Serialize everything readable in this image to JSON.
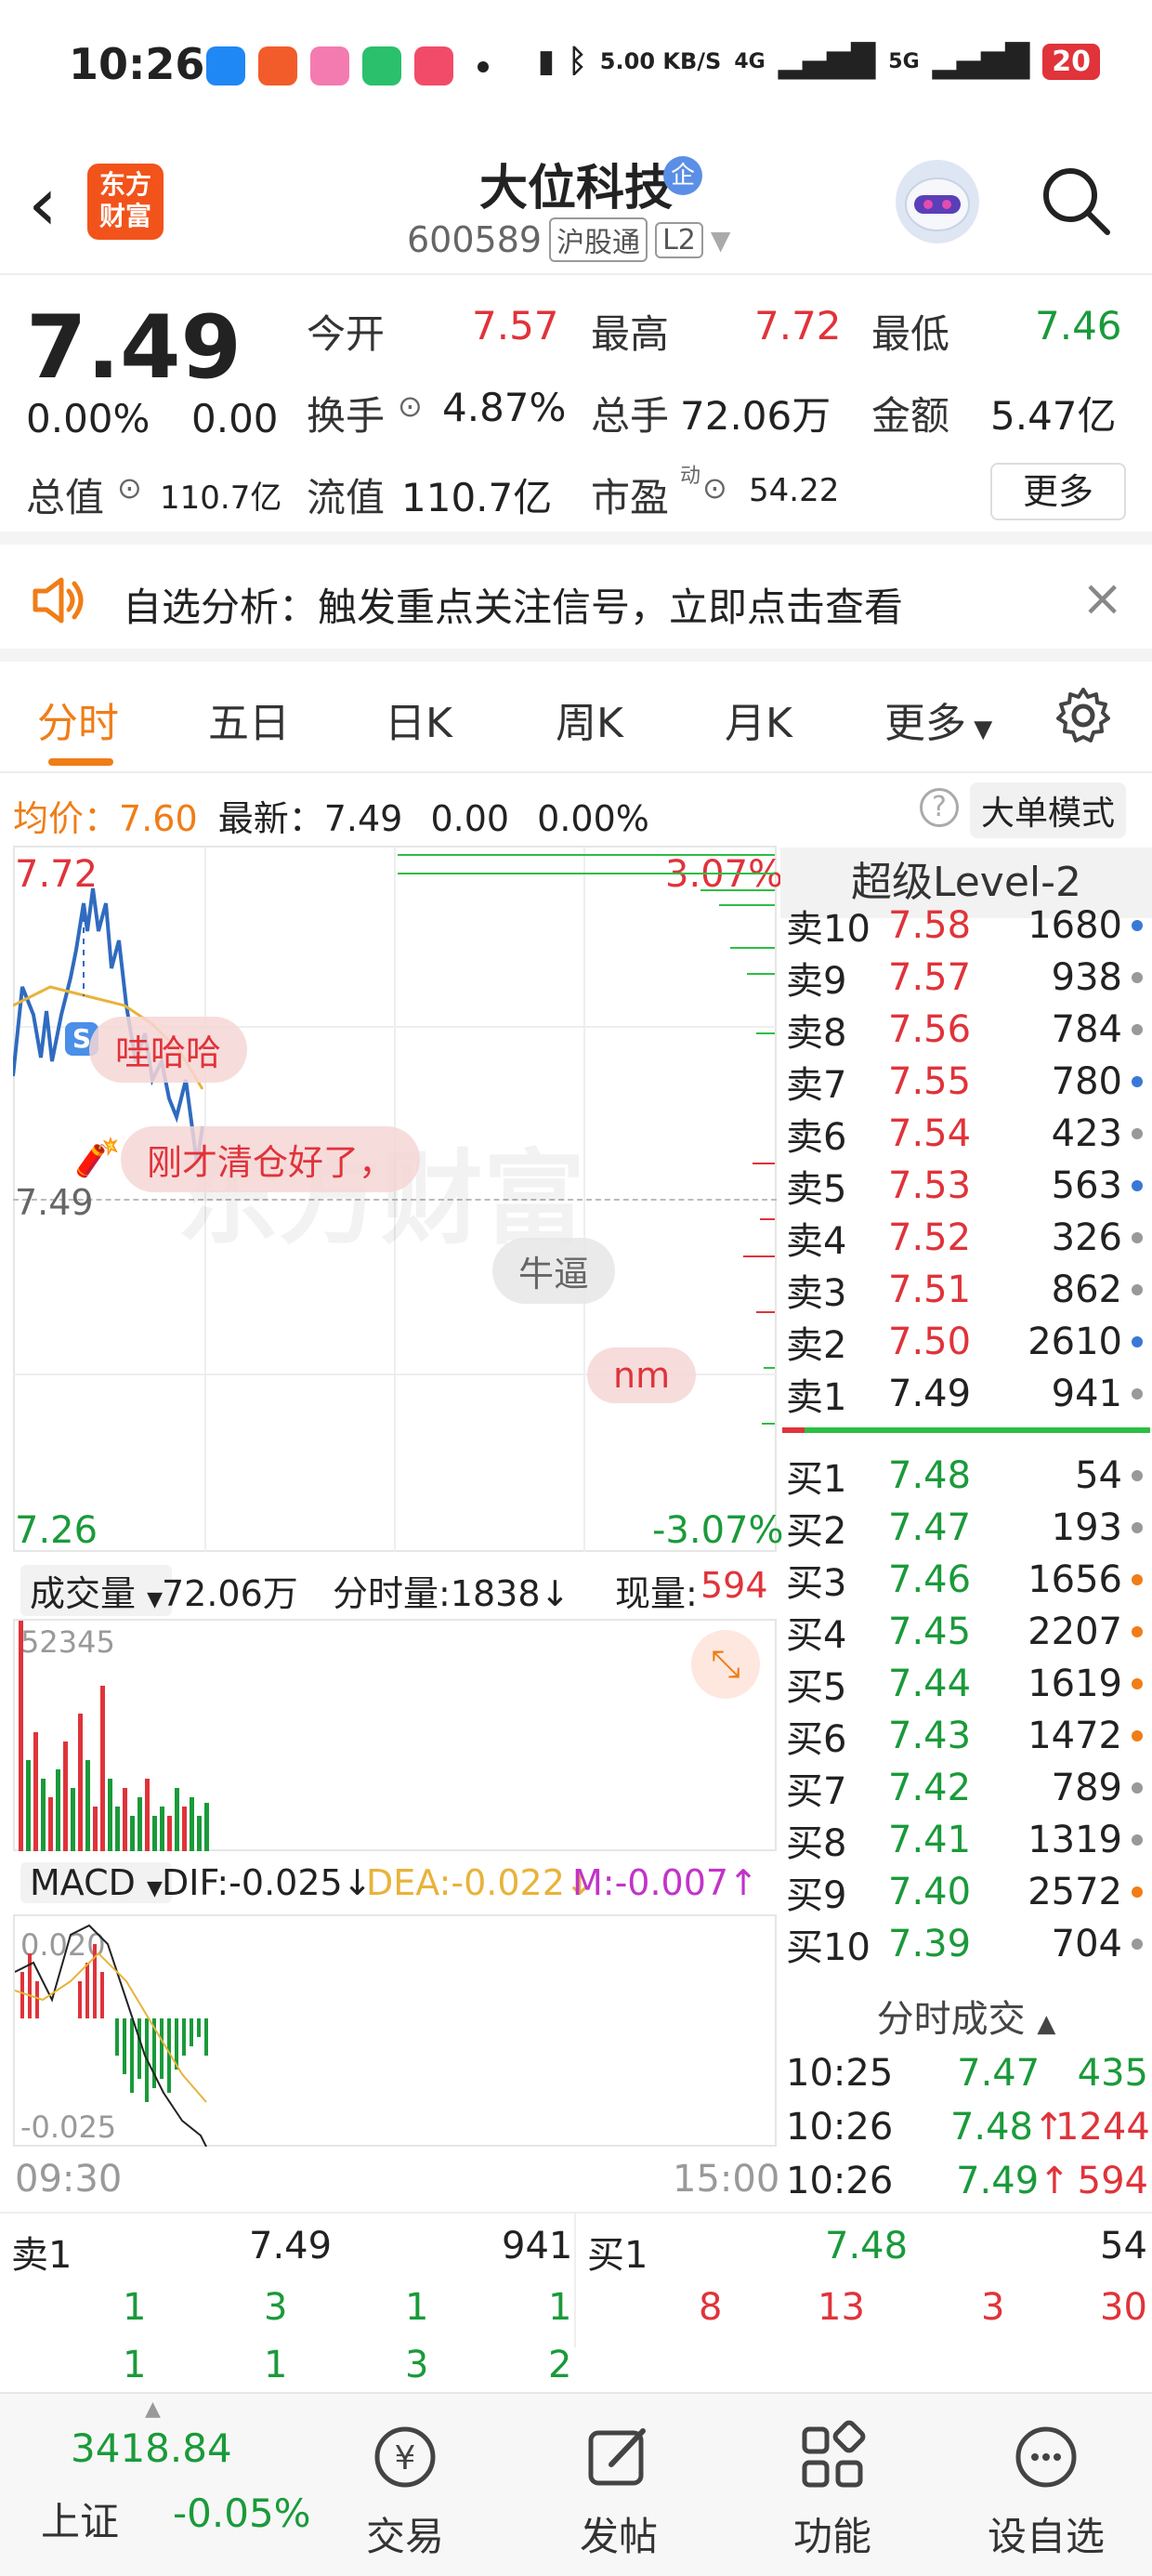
{
  "status_bar": {
    "time": "10:26",
    "net_speed": "5.00 KB/S",
    "signal1": "4G",
    "signal2": "5G",
    "battery": "20"
  },
  "header": {
    "back_icon": "chevron-left-icon",
    "logo_line1": "东方",
    "logo_line2": "财富",
    "stock_name": "大位科技",
    "qi_badge": "企",
    "stock_code": "600589",
    "tag_hgt": "沪股通",
    "tag_level": "L2"
  },
  "quote": {
    "price": "7.49",
    "change_pct": "0.00%",
    "change_abs": "0.00",
    "open_label": "今开",
    "open": "7.57",
    "high_label": "最高",
    "high": "7.72",
    "low_label": "最低",
    "low": "7.46",
    "turnover_label": "换手",
    "turnover": "4.87%",
    "volume_label": "总手",
    "volume": "72.06万",
    "amount_label": "金额",
    "amount": "5.47亿",
    "mktcap_label": "总值",
    "mktcap": "110.7亿",
    "float_label": "流值",
    "float": "110.7亿",
    "pe_label": "市盈",
    "pe_sup": "动",
    "pe": "54.22",
    "more": "更多"
  },
  "banner": {
    "text": "自选分析：触发重点关注信号，立即点击查看"
  },
  "tabs": [
    "分时",
    "五日",
    "日K",
    "周K",
    "月K",
    "更多"
  ],
  "info_row": {
    "avg_label": "均价：",
    "avg": "7.60",
    "latest_label": "最新：",
    "latest": "7.49",
    "chg": "0.00",
    "chg_pct": "0.00%",
    "big_mode": "大单模式"
  },
  "intraday": {
    "top_price": "7.72",
    "top_pct": "3.07%",
    "mid_price": "7.49",
    "bottom_price": "7.26",
    "bottom_pct": "-3.07%",
    "watermark": "东方财富",
    "bubbles": [
      "哇哈哈",
      "刚才清仓好了，",
      "牛逼",
      "nm"
    ],
    "s_badge": "S"
  },
  "volume_panel": {
    "label": "成交量",
    "total": "72.06万",
    "interval_label": "分时量:1838↓",
    "current_label": "现量:",
    "current": "594",
    "max": "52345"
  },
  "macd_panel": {
    "label": "MACD",
    "dif": "DIF:-0.025↓",
    "dea": "DEA:-0.022↓",
    "m": "M:-0.007↑",
    "top": "0.020",
    "bottom": "-0.025",
    "time_start": "09:30",
    "time_end": "15:00"
  },
  "order_book": {
    "title": "超级Level-2",
    "asks": [
      {
        "label": "卖10",
        "price": "7.58",
        "vol": "1680",
        "dot": "#3a78d6"
      },
      {
        "label": "卖9",
        "price": "7.57",
        "vol": "938",
        "dot": "#999999"
      },
      {
        "label": "卖8",
        "price": "7.56",
        "vol": "784",
        "dot": "#999999"
      },
      {
        "label": "卖7",
        "price": "7.55",
        "vol": "780",
        "dot": "#3a78d6"
      },
      {
        "label": "卖6",
        "price": "7.54",
        "vol": "423",
        "dot": "#999999"
      },
      {
        "label": "卖5",
        "price": "7.53",
        "vol": "563",
        "dot": "#3a78d6"
      },
      {
        "label": "卖4",
        "price": "7.52",
        "vol": "326",
        "dot": "#999999"
      },
      {
        "label": "卖3",
        "price": "7.51",
        "vol": "862",
        "dot": "#999999"
      },
      {
        "label": "卖2",
        "price": "7.50",
        "vol": "2610",
        "dot": "#3a78d6"
      },
      {
        "label": "卖1",
        "price": "7.49",
        "vol": "941",
        "dot": "#999999"
      }
    ],
    "bids": [
      {
        "label": "买1",
        "price": "7.48",
        "vol": "54",
        "dot": "#999999"
      },
      {
        "label": "买2",
        "price": "7.47",
        "vol": "193",
        "dot": "#999999"
      },
      {
        "label": "买3",
        "price": "7.46",
        "vol": "1656",
        "dot": "#f07d17"
      },
      {
        "label": "买4",
        "price": "7.45",
        "vol": "2207",
        "dot": "#f07d17"
      },
      {
        "label": "买5",
        "price": "7.44",
        "vol": "1619",
        "dot": "#f07d17"
      },
      {
        "label": "买6",
        "price": "7.43",
        "vol": "1472",
        "dot": "#f07d17"
      },
      {
        "label": "买7",
        "price": "7.42",
        "vol": "789",
        "dot": "#999999"
      },
      {
        "label": "买8",
        "price": "7.41",
        "vol": "1319",
        "dot": "#999999"
      },
      {
        "label": "买9",
        "price": "7.40",
        "vol": "2572",
        "dot": "#f07d17"
      },
      {
        "label": "买10",
        "price": "7.39",
        "vol": "704",
        "dot": "#999999"
      }
    ]
  },
  "ticks": {
    "title": "分时成交",
    "rows": [
      {
        "time": "10:25",
        "price": "7.47",
        "vol": "435",
        "arrow": ""
      },
      {
        "time": "10:26",
        "price": "7.48",
        "vol": "1244",
        "arrow": "↑"
      },
      {
        "time": "10:26",
        "price": "7.49",
        "vol": "594",
        "arrow": "↑"
      }
    ]
  },
  "level1": {
    "ask_label": "卖1",
    "ask_price": "7.49",
    "ask_vol": "941",
    "bid_label": "买1",
    "bid_price": "7.48",
    "bid_vol": "54",
    "ask_queue": [
      "1",
      "3",
      "1",
      "1",
      "1",
      "1",
      "3",
      "2"
    ],
    "bid_queue": [
      "8",
      "13",
      "3",
      "30"
    ]
  },
  "bottom_nav": {
    "index_value": "3418.84",
    "index_name": "上证",
    "index_change": "-0.05%",
    "items": [
      "交易",
      "发帖",
      "功能",
      "设自选"
    ]
  }
}
